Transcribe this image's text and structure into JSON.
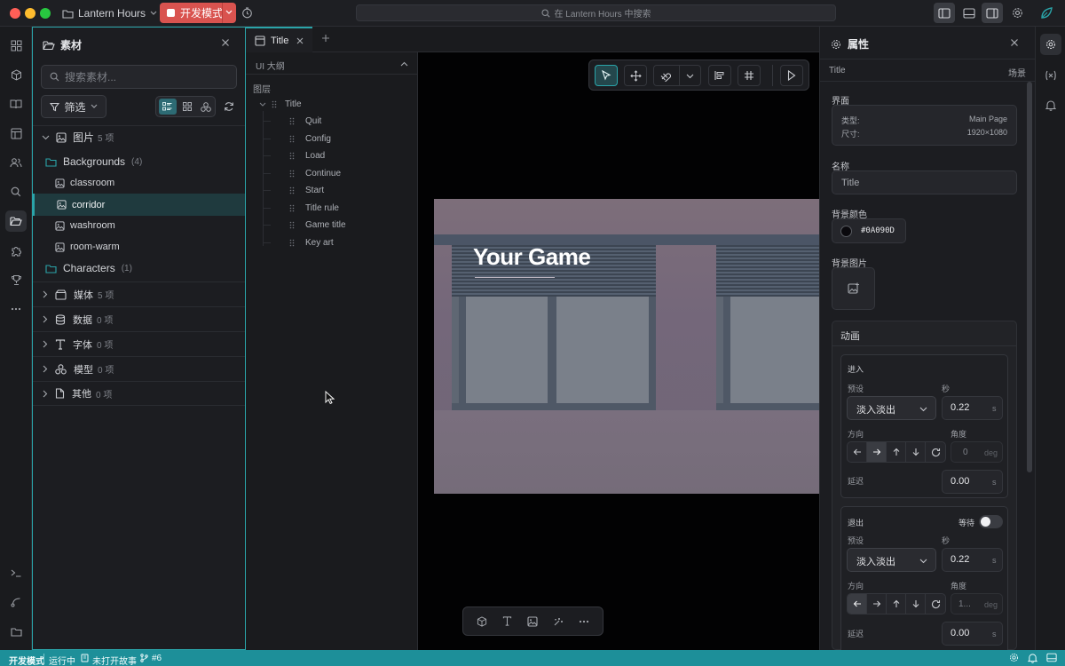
{
  "colors": {
    "accent": "#2aa4a9",
    "dev_mode": "#d9534f",
    "status_bar": "#1d8f99",
    "bg_color_value": "#0A090D"
  },
  "titlebar": {
    "project_name": "Lantern Hours",
    "dev_mode_label": "开发模式",
    "search_placeholder": "在 Lantern Hours 中搜索"
  },
  "assets": {
    "title": "素材",
    "search_placeholder": "搜索素材...",
    "filter_label": "筛选",
    "images": {
      "label": "图片",
      "count": "5 项"
    },
    "backgrounds": {
      "label": "Backgrounds",
      "count": "(4)"
    },
    "bg_items": [
      "classroom",
      "corridor",
      "washroom",
      "room-warm"
    ],
    "characters": {
      "label": "Characters",
      "count": "(1)"
    },
    "categories": [
      {
        "label": "媒体",
        "count": "5 项"
      },
      {
        "label": "数据",
        "count": "0 项"
      },
      {
        "label": "字体",
        "count": "0 项"
      },
      {
        "label": "模型",
        "count": "0 项"
      },
      {
        "label": "其他",
        "count": "0 项"
      }
    ]
  },
  "editor": {
    "tab_label": "Title",
    "outline_title": "UI 大纲",
    "layers_label": "图层",
    "root_node": "Title",
    "nodes": [
      "Quit",
      "Config",
      "Load",
      "Continue",
      "Start",
      "Title rule",
      "Game title",
      "Key art"
    ],
    "canvas_title_text": "Your Game"
  },
  "inspector": {
    "title": "属性",
    "breadcrumb_left": "Title",
    "breadcrumb_right": "场景",
    "screen_section": "界面",
    "type_label": "类型:",
    "type_value": "Main Page",
    "size_label": "尺寸:",
    "size_value": "1920×1080",
    "name_label": "名称",
    "name_value": "Title",
    "bg_color_label": "背景颜色",
    "bg_color_value": "#0A090D",
    "bg_image_label": "背景图片",
    "animation_section": "动画",
    "enter": {
      "title": "进入",
      "preset_label": "预设",
      "seconds_label": "秒",
      "preset_value": "淡入淡出",
      "seconds_value": "0.22",
      "unit_s": "s",
      "direction_label": "方向",
      "angle_label": "角度",
      "angle_value": "0",
      "unit_deg": "deg",
      "delay_label": "延迟",
      "delay_value": "0.00",
      "delay_unit": "s"
    },
    "exit": {
      "title": "退出",
      "wait_label": "等待",
      "preset_label": "预设",
      "seconds_label": "秒",
      "preset_value": "淡入淡出",
      "seconds_value": "0.22",
      "unit_s": "s",
      "direction_label": "方向",
      "angle_label": "角度",
      "angle_value": "1...",
      "unit_deg": "deg",
      "delay_label": "延迟",
      "delay_value": "0.00",
      "delay_unit": "s"
    }
  },
  "statusbar": {
    "mode": "开发模式",
    "running": "运行中",
    "story": "未打开故事",
    "branch": "#6"
  }
}
